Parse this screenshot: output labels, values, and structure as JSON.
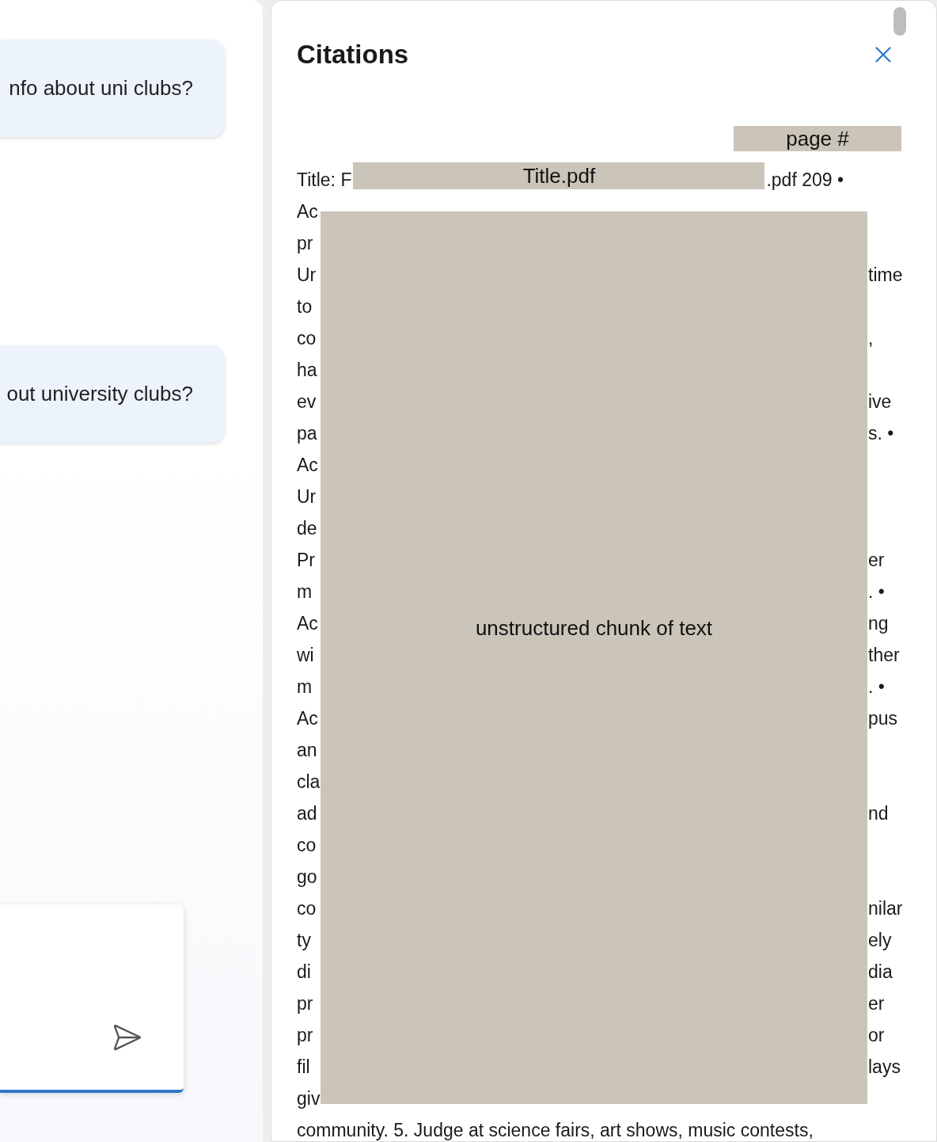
{
  "chat": {
    "messages": [
      {
        "text": "nfo about uni clubs?"
      },
      {
        "text": "out university clubs?"
      }
    ]
  },
  "citations": {
    "title": "Citations",
    "page_label": "page #",
    "source": {
      "prefix": "Title: F",
      "label": "Title.pdf",
      "suffix": ".pdf 209 •"
    },
    "chunk_label": "unstructured chunk of text",
    "lines": [
      {
        "left": "Ac"
      },
      {
        "left": "pr"
      },
      {
        "left": "Ur",
        "right": "time"
      },
      {
        "left": "to"
      },
      {
        "left": "co",
        "right": ","
      },
      {
        "left": "ha"
      },
      {
        "left": "ev",
        "right": "ive"
      },
      {
        "left": "pa",
        "right": "s. •"
      },
      {
        "left": "Ac"
      },
      {
        "left": "Ur"
      },
      {
        "left": "de"
      },
      {
        "left": "Pr",
        "right": "er"
      },
      {
        "left": "m",
        "right": ". •"
      },
      {
        "left": "Ac",
        "right": "ng"
      },
      {
        "left": "wi",
        "right": "ther"
      },
      {
        "left": "m",
        "right": ". •"
      },
      {
        "left": "Ac",
        "right": "pus"
      },
      {
        "left": "an"
      },
      {
        "left": "cla"
      },
      {
        "left": "ad",
        "right": "nd"
      },
      {
        "left": "co"
      },
      {
        "left": "go"
      },
      {
        "left": "co",
        "right": "nilar"
      },
      {
        "left": "ty",
        "right": "ely"
      },
      {
        "left": "di",
        "right": "dia"
      },
      {
        "left": "pr",
        "right": "er"
      },
      {
        "left": "pr",
        "right": "or"
      },
      {
        "left": "fil",
        "right": "lays"
      },
      {
        "left": "giv"
      },
      {
        "left": "community. 5. Judge at science fairs, art shows, music contests,"
      }
    ]
  }
}
